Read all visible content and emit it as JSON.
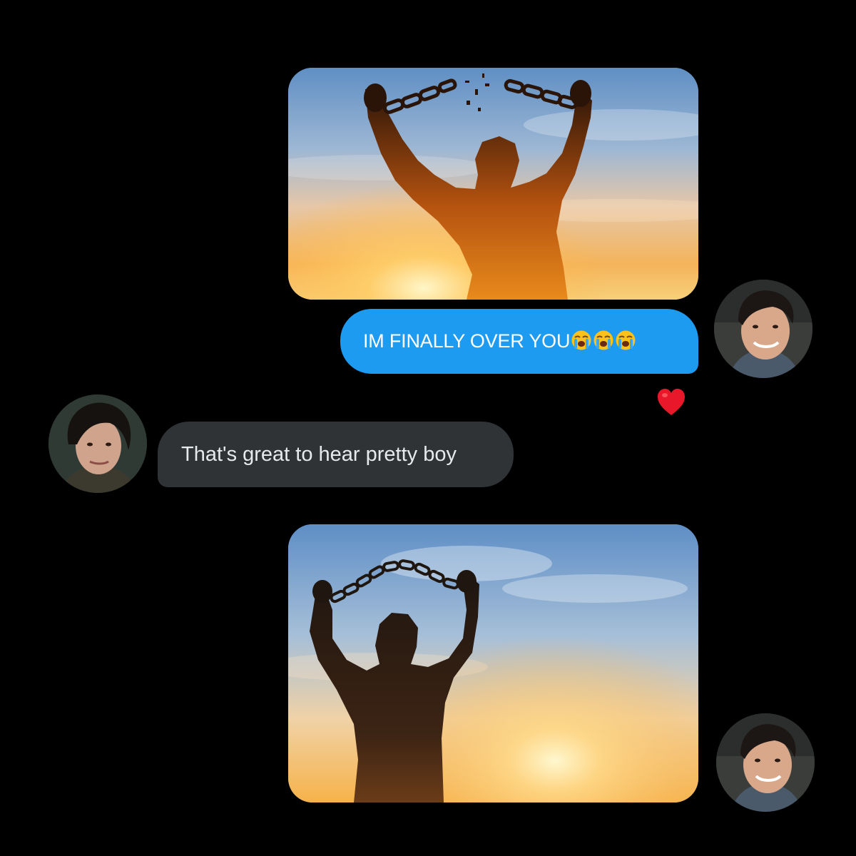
{
  "conversation": {
    "messages": [
      {
        "from": "me",
        "type": "image",
        "image": "sunset-broken-chains-photo"
      },
      {
        "from": "me",
        "type": "text",
        "text": "IM FINALLY OVER YOU",
        "emoji": [
          "loudly-crying-face",
          "loudly-crying-face",
          "loudly-crying-face"
        ],
        "reaction": "red-heart"
      },
      {
        "from": "other",
        "type": "text",
        "text": "That's great to hear pretty boy"
      },
      {
        "from": "me",
        "type": "image",
        "image": "sunset-broken-chains-photo"
      }
    ]
  },
  "colors": {
    "background": "#000000",
    "sent_bubble": "#1d9bf0",
    "received_bubble": "#2f3336",
    "reaction_heart": "#e8182a"
  }
}
